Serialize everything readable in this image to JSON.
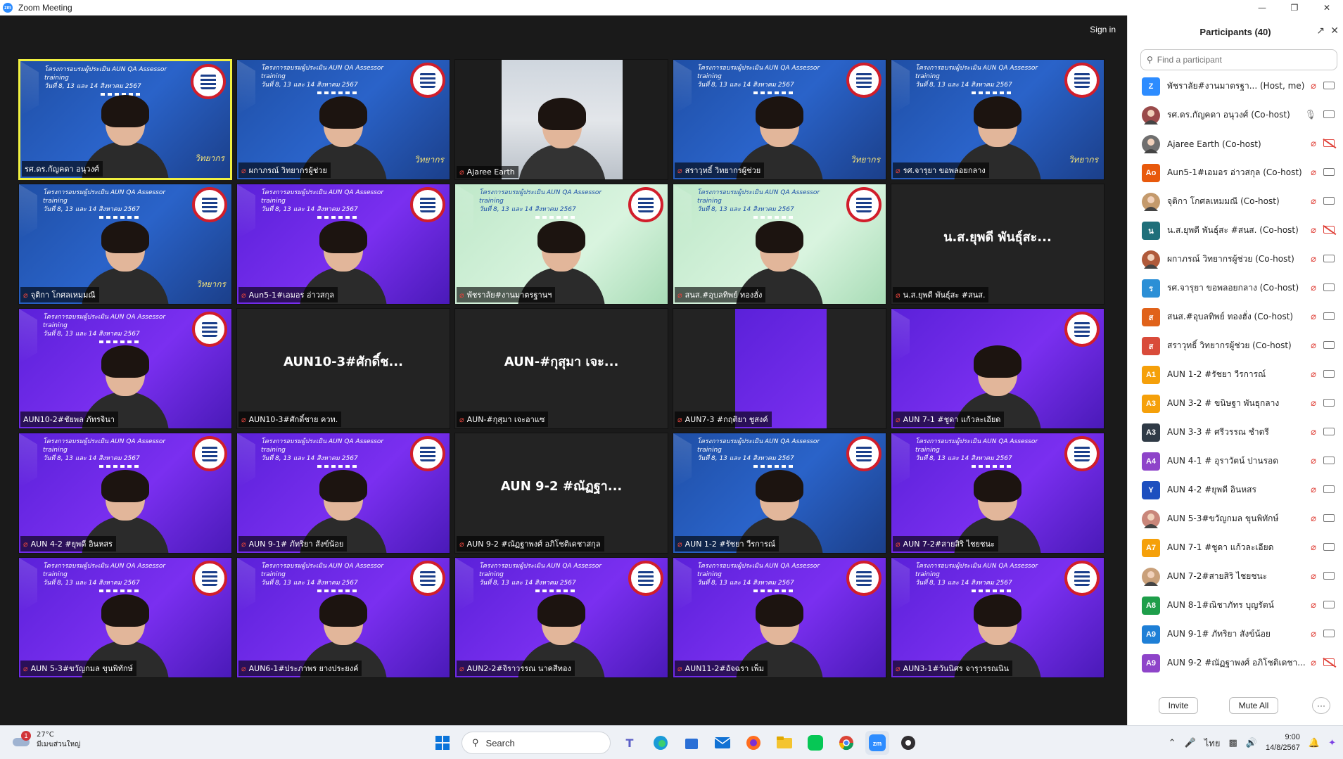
{
  "window": {
    "title": "Zoom Meeting",
    "logo_text": "zm",
    "controls": [
      "minimize",
      "restore",
      "close"
    ]
  },
  "meeting": {
    "sign_in_label": "Sign in",
    "tiles": [
      {
        "name": "รศ.ดร.กัญคดา อนุวงศ์",
        "bg": "blue",
        "active": true,
        "mic_off": false,
        "watermark": "วิทยากร",
        "banner": "โครงการอบรมผู้ประเมิน AUN QA Assessor training|วันที่ 8, 13 และ 14 สิงหาคม 2567"
      },
      {
        "name": "ผกาภรณ์ วิทยากรผู้ช่วย",
        "bg": "blue",
        "active": false,
        "mic_off": true,
        "watermark": "วิทยากร",
        "banner": "โครงการอบรมผู้ประเมิน AUN QA Assessor training|วันที่ 8, 13 และ 14 สิงหาคม 2567"
      },
      {
        "name": "Ajaree  Earth",
        "bg": "photo",
        "active": false,
        "mic_off": true,
        "watermark": "",
        "banner": ""
      },
      {
        "name": "สราวุทธิ์ วิทยากรผู้ช่วย",
        "bg": "blue",
        "active": false,
        "mic_off": true,
        "watermark": "วิทยากร",
        "banner": "โครงการอบรมผู้ประเมิน AUN QA Assessor training|วันที่ 8, 13 และ 14 สิงหาคม 2567"
      },
      {
        "name": "รศ.จารุยา ขอพลอยกลาง",
        "bg": "blue",
        "active": false,
        "mic_off": true,
        "watermark": "วิทยากร",
        "banner": "โครงการอบรมผู้ประเมิน AUN QA Assessor training|วันที่ 8, 13 และ 14 สิงหาคม 2567"
      },
      {
        "name": "จุติกา โกศลเหมมณี",
        "bg": "blue",
        "active": false,
        "mic_off": true,
        "watermark": "วิทยากร",
        "banner": "โครงการอบรมผู้ประเมิน AUN QA Assessor training|วันที่ 8, 13 และ 14 สิงหาคม 2567"
      },
      {
        "name": "Aun5-1#เอมอร อ่าวสกุล",
        "bg": "purple",
        "active": false,
        "mic_off": true,
        "watermark": "",
        "banner": "โครงการอบรมผู้ประเมิน AUN QA Assessor training|วันที่ 8, 13 และ 14 สิงหาคม 2567"
      },
      {
        "name": "พัชราลัย#งานมาตรฐานฯ",
        "bg": "green",
        "active": false,
        "mic_off": true,
        "watermark": "",
        "banner": "โครงการอบรมผู้ประเมิน AUN QA Assessor training|วันที่ 8, 13 และ 14 สิงหาคม 2567"
      },
      {
        "name": "สนส.#อุบลทิพย์ ทองฮั่ง",
        "bg": "green",
        "active": false,
        "mic_off": true,
        "watermark": "",
        "banner": "โครงการอบรมผู้ประเมิน AUN QA Assessor training|วันที่ 8, 13 และ 14 สิงหาคม 2567"
      },
      {
        "name": "น.ส.ยุพดี พันธุ์สะ #สนส.",
        "bg": "dark",
        "active": false,
        "mic_off": true,
        "big": "น.ส.ยุพดี พันธุ์สะ...",
        "watermark": "",
        "banner": ""
      },
      {
        "name": "AUN10-2#ชัยพล ภัทรจินา",
        "bg": "purple",
        "active": false,
        "mic_off": false,
        "watermark": "",
        "banner": "โครงการอบรมผู้ประเมิน AUN QA Assessor training|วันที่ 8, 13 และ 14 สิงหาคม 2567"
      },
      {
        "name": "AUN10-3#ศักดิ์ชาย ควท.",
        "bg": "dark",
        "active": false,
        "mic_off": true,
        "big": "AUN10-3#ศักดิ์ช...",
        "watermark": "",
        "banner": ""
      },
      {
        "name": "AUN-#กุสุมา  เจะอาแซ",
        "bg": "dark",
        "active": false,
        "mic_off": true,
        "big": "AUN-#กุสุมา  เจะ...",
        "watermark": "",
        "banner": ""
      },
      {
        "name": "AUN7-3 #กฤติยา ชูสงค์",
        "bg": "narrow",
        "active": false,
        "mic_off": true,
        "watermark": "",
        "banner": ""
      },
      {
        "name": "AUN 7-1 #ชูดา แก้วละเอียด",
        "bg": "purple",
        "active": false,
        "mic_off": true,
        "watermark": "",
        "banner": ""
      },
      {
        "name": "AUN 4-2 #ยุพดี อินหสร",
        "bg": "purple",
        "active": false,
        "mic_off": true,
        "watermark": "",
        "banner": "โครงการอบรมผู้ประเมิน AUN QA Assessor training|วันที่ 8, 13 และ 14 สิงหาคม 2567"
      },
      {
        "name": "AUN 9-1# ภัทริยา  สังข์น้อย",
        "bg": "purple",
        "active": false,
        "mic_off": true,
        "watermark": "",
        "banner": "โครงการอบรมผู้ประเมิน AUN QA Assessor training|วันที่ 8, 13 และ 14 สิงหาคม 2567"
      },
      {
        "name": "AUN 9-2 #ณัฏฐาพงศ์ อภิโชติเดชาสกุล",
        "bg": "dark",
        "active": false,
        "mic_off": true,
        "big": "AUN 9-2 #ณัฏฐา...",
        "watermark": "",
        "banner": ""
      },
      {
        "name": "AUN 1-2 #รัชยา วีรการณ์",
        "bg": "blue",
        "active": false,
        "mic_off": true,
        "watermark": "",
        "banner": "โครงการอบรมผู้ประเมิน AUN QA Assessor training|วันที่ 8, 13 และ 14 สิงหาคม 2567"
      },
      {
        "name": "AUN 7-2#สายสิริ ไชยชนะ",
        "bg": "purple",
        "active": false,
        "mic_off": true,
        "watermark": "",
        "banner": "โครงการอบรมผู้ประเมิน AUN QA Assessor training|วันที่ 8, 13 และ 14 สิงหาคม 2567"
      },
      {
        "name": "AUN 5-3#ขวัญกมล ขุนพิทักษ์",
        "bg": "purple",
        "active": false,
        "mic_off": true,
        "watermark": "",
        "banner": "โครงการอบรมผู้ประเมิน AUN QA Assessor training|วันที่ 8, 13 และ 14 สิงหาคม 2567"
      },
      {
        "name": "AUN6-1#ประภาพร ยางประยงค์",
        "bg": "purple",
        "active": false,
        "mic_off": true,
        "watermark": "",
        "banner": "โครงการอบรมผู้ประเมิน AUN QA Assessor training|วันที่ 8, 13 และ 14 สิงหาคม 2567"
      },
      {
        "name": "AUN2-2#จิราวรรณ นาคสีทอง",
        "bg": "purple",
        "active": false,
        "mic_off": true,
        "watermark": "",
        "banner": "โครงการอบรมผู้ประเมิน AUN QA Assessor training|วันที่ 8, 13 และ 14 สิงหาคม 2567"
      },
      {
        "name": "AUN11-2#อัจฉรา เพ็ม",
        "bg": "purple",
        "active": false,
        "mic_off": true,
        "watermark": "",
        "banner": "โครงการอบรมผู้ประเมิน AUN QA Assessor training|วันที่ 8, 13 และ 14 สิงหาคม 2567"
      },
      {
        "name": "AUN3-1#วันนิศร จารุวรรณนิน",
        "bg": "purple",
        "active": false,
        "mic_off": true,
        "watermark": "",
        "banner": "โครงการอบรมผู้ประเมิน AUN QA Assessor training|วันที่ 8, 13 และ 14 สิงหาคม 2567"
      }
    ]
  },
  "panel": {
    "title": "Participants (40)",
    "search_placeholder": "Find a participant",
    "participants": [
      {
        "initials": "Z",
        "color": "#2d8cff",
        "name": "พัชราลัย#งานมาตรฐา... (Host, me)",
        "mic": "off",
        "cam": "on"
      },
      {
        "initials": "",
        "color": "#9a4a4a",
        "name": "รศ.ดร.กัญคดา อนุวงศ์ (Co-host)",
        "mic": "on",
        "cam": "on"
      },
      {
        "initials": "",
        "color": "#6f6f6f",
        "name": "Ajaree  Earth (Co-host)",
        "mic": "off",
        "cam": "off"
      },
      {
        "initials": "Ao",
        "color": "#e8590c",
        "name": "Aun5-1#เอมอร อ่าวสกุล (Co-host)",
        "mic": "off",
        "cam": "on"
      },
      {
        "initials": "",
        "color": "#c49a6c",
        "name": "จุติกา โกศลเหมมณี (Co-host)",
        "mic": "off",
        "cam": "on"
      },
      {
        "initials": "น",
        "color": "#1f6f7a",
        "name": "น.ส.ยุพดี พันธุ์สะ #สนส. (Co-host)",
        "mic": "off",
        "cam": "off"
      },
      {
        "initials": "",
        "color": "#b05a3a",
        "name": "ผกาภรณ์ วิทยากรผู้ช่วย (Co-host)",
        "mic": "off",
        "cam": "on"
      },
      {
        "initials": "ร",
        "color": "#2b8fd6",
        "name": "รศ.จารุยา ขอพลอยกลาง (Co-host)",
        "mic": "off",
        "cam": "on"
      },
      {
        "initials": "ส",
        "color": "#e0621a",
        "name": "สนส.#อุบลทิพย์ ทองฮั่ง (Co-host)",
        "mic": "off",
        "cam": "on"
      },
      {
        "initials": "ส",
        "color": "#d94b3a",
        "name": "สราวุทธิ์ วิทยากรผู้ช่วย (Co-host)",
        "mic": "off",
        "cam": "on"
      },
      {
        "initials": "A1",
        "color": "#f5a00a",
        "name": "AUN 1-2 #รัชยา วีรการณ์",
        "mic": "off",
        "cam": "on"
      },
      {
        "initials": "A3",
        "color": "#f5a00a",
        "name": "AUN 3-2 # ขนิษฐา พันธุกลาง",
        "mic": "off",
        "cam": "on"
      },
      {
        "initials": "A3",
        "color": "#2f3a46",
        "name": "AUN 3-3 # ศรีวรรณ ชำตรี",
        "mic": "off",
        "cam": "on"
      },
      {
        "initials": "A4",
        "color": "#8e44c9",
        "name": "AUN 4-1 # อุราวัตน์ ปานรอด",
        "mic": "off",
        "cam": "on"
      },
      {
        "initials": "Y",
        "color": "#1d4fbf",
        "name": "AUN 4-2 #ยุพดี อินหสร",
        "mic": "off",
        "cam": "on"
      },
      {
        "initials": "",
        "color": "#c9867a",
        "name": "AUN 5-3#ขวัญกมล ขุนพิทักษ์",
        "mic": "off",
        "cam": "on"
      },
      {
        "initials": "A7",
        "color": "#f5a00a",
        "name": "AUN 7-1 #ชูดา แก้วละเอียด",
        "mic": "off",
        "cam": "on"
      },
      {
        "initials": "",
        "color": "#c9a07a",
        "name": "AUN 7-2#สายสิริ ไชยชนะ",
        "mic": "off",
        "cam": "on"
      },
      {
        "initials": "A8",
        "color": "#1e9e4a",
        "name": "AUN 8-1#ณิชาภัทร บุญรัตน์",
        "mic": "off",
        "cam": "on"
      },
      {
        "initials": "A9",
        "color": "#1e7fd6",
        "name": "AUN 9-1# ภัทริยา  สังข์น้อย",
        "mic": "off",
        "cam": "on"
      },
      {
        "initials": "A9",
        "color": "#8e44c9",
        "name": "AUN 9-2 #ณัฏฐาพงศ์ อภิโชติเดชา...",
        "mic": "off",
        "cam": "off"
      }
    ],
    "invite_label": "Invite",
    "mute_all_label": "Mute All",
    "more_label": "···"
  },
  "taskbar": {
    "weather_badge": "1",
    "weather_temp": "27°C",
    "weather_desc": "มีเมฆส่วนใหญ่",
    "search_label": "Search",
    "language": "ไทย",
    "time": "9:00",
    "date": "14/8/2567"
  }
}
